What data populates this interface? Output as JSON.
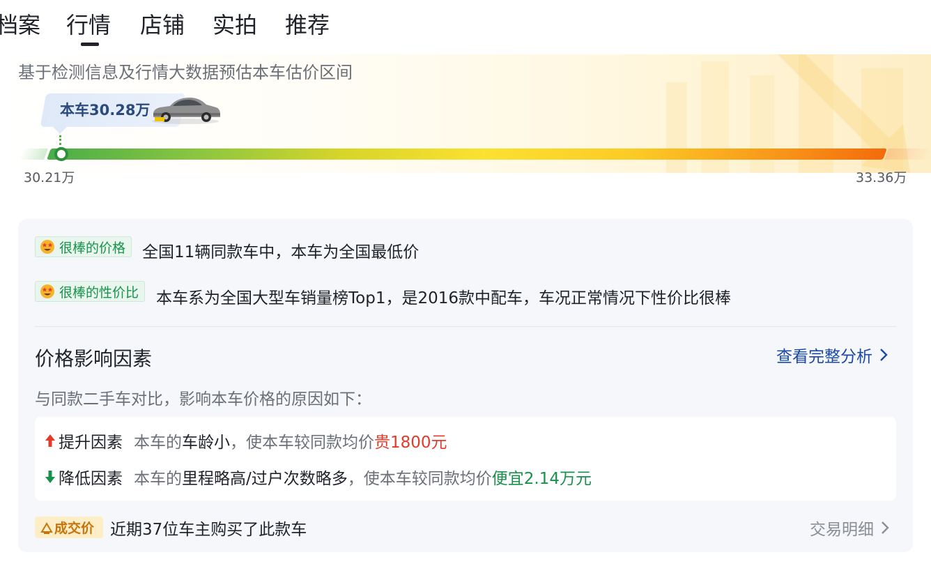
{
  "tabs": [
    {
      "label": "档案"
    },
    {
      "label": "行情",
      "active": true
    },
    {
      "label": "店铺"
    },
    {
      "label": "实拍"
    },
    {
      "label": "推荐"
    }
  ],
  "hero": {
    "subtitle": "基于检测信息及行情大数据预估本车估价区间",
    "current_price": "本车30.28万",
    "range_min": "30.21万",
    "range_max": "33.36万"
  },
  "highlights": [
    {
      "badge": "很棒的价格",
      "text": "全国11辆同款车中，本车为全国最低价",
      "icon": "star-struck-emoji-icon"
    },
    {
      "badge": "很棒的性价比",
      "text": "本车系为全国大型车销量榜Top1，是2016款中配车，车况正常情况下性价比很棒",
      "icon": "star-struck-emoji-icon"
    }
  ],
  "factors": {
    "title": "价格影响因素",
    "link": "查看完整分析",
    "description": "与同款二手车对比，影响本车价格的原因如下：",
    "up": {
      "label": "提升因素",
      "prefix": "本车的",
      "highlight": "车龄小",
      "middle": "，使本车较同款均价",
      "effect": "贵1800元"
    },
    "down": {
      "label": "降低因素",
      "prefix": "本车的",
      "highlight": "里程略高/过户次数略多",
      "middle": "，使本车较同款均价",
      "effect": "便宜2.14万元"
    }
  },
  "deal": {
    "badge": "成交价",
    "text": "近期37位车主购买了此款车",
    "link": "交易明细"
  },
  "colors": {
    "up": "#e23b2a",
    "down": "#17924a",
    "link": "#1a49a8",
    "badge_green": "#17924a",
    "deal_orange": "#c8740c"
  }
}
